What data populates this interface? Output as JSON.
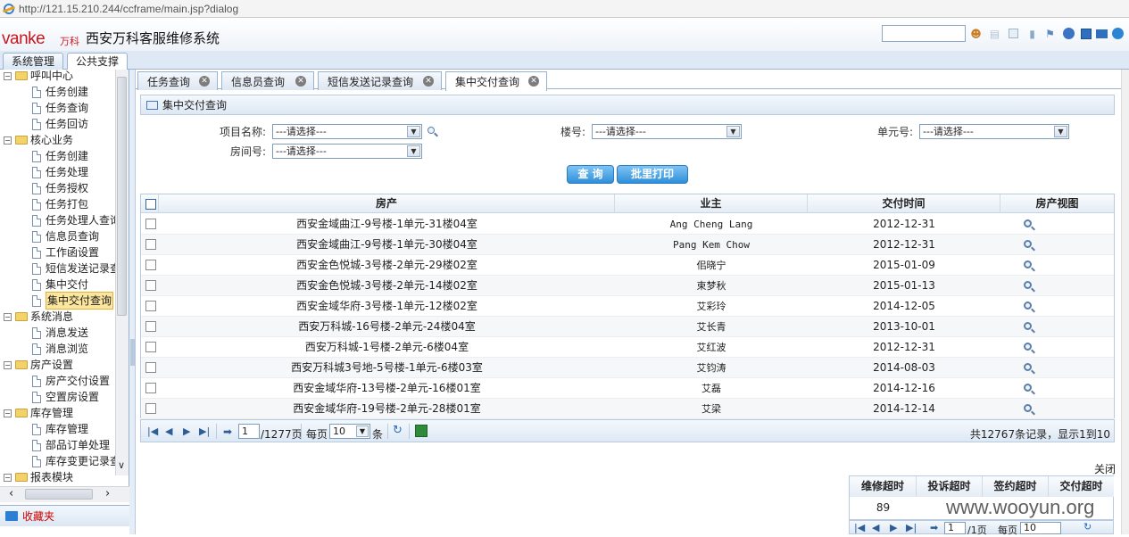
{
  "browser": {
    "url": "http://121.15.210.244/ccframe/main.jsp?dialog"
  },
  "header": {
    "logo": "vanke",
    "logo_cn": "万科",
    "title": "西安万科客服维修系统",
    "icons": [
      "users-icon",
      "document-icon",
      "close-square-icon",
      "book-icon",
      "bookmark-icon",
      "lock-icon",
      "layout-icon",
      "mail-icon",
      "help-icon"
    ]
  },
  "topnav": {
    "tabs": [
      {
        "label": "系统管理"
      },
      {
        "label": "公共支撑"
      }
    ]
  },
  "tree": {
    "nodes": [
      {
        "type": "folder",
        "label": "呼叫中心"
      },
      {
        "type": "doc",
        "label": "任务创建"
      },
      {
        "type": "doc",
        "label": "任务查询"
      },
      {
        "type": "doc",
        "label": "任务回访"
      },
      {
        "type": "folder",
        "label": "核心业务"
      },
      {
        "type": "doc",
        "label": "任务创建"
      },
      {
        "type": "doc",
        "label": "任务处理"
      },
      {
        "type": "doc",
        "label": "任务授权"
      },
      {
        "type": "doc",
        "label": "任务打包"
      },
      {
        "type": "doc",
        "label": "任务处理人查询"
      },
      {
        "type": "doc",
        "label": "信息员查询"
      },
      {
        "type": "doc",
        "label": "工作函设置"
      },
      {
        "type": "doc",
        "label": "短信发送记录查询"
      },
      {
        "type": "doc",
        "label": "集中交付"
      },
      {
        "type": "doc",
        "label": "集中交付查询",
        "selected": true
      },
      {
        "type": "folder",
        "label": "系统消息"
      },
      {
        "type": "doc",
        "label": "消息发送"
      },
      {
        "type": "doc",
        "label": "消息浏览"
      },
      {
        "type": "folder",
        "label": "房产设置"
      },
      {
        "type": "doc",
        "label": "房产交付设置"
      },
      {
        "type": "doc",
        "label": "空置房设置"
      },
      {
        "type": "folder",
        "label": "库存管理"
      },
      {
        "type": "doc",
        "label": "库存管理"
      },
      {
        "type": "doc",
        "label": "部品订单处理"
      },
      {
        "type": "doc",
        "label": "库存变更记录查询"
      },
      {
        "type": "folder",
        "label": "报表模块"
      }
    ],
    "favorites": "收藏夹"
  },
  "content_tabs": [
    {
      "label": "任务查询"
    },
    {
      "label": "信息员查询"
    },
    {
      "label": "短信发送记录查询"
    },
    {
      "label": "集中交付查询",
      "active": true
    }
  ],
  "panel": {
    "title": "集中交付查询",
    "filters": {
      "project_label": "项目名称:",
      "building_label": "楼号:",
      "unit_label": "单元号:",
      "room_label": "房间号:",
      "select_placeholder": "---请选择---"
    },
    "buttons": {
      "query": "查 询",
      "batch_print": "批里打印"
    }
  },
  "grid": {
    "columns": [
      "房产",
      "业主",
      "交付时间",
      "房产视图"
    ],
    "rows": [
      {
        "property": "西安金域曲江-9号楼-1单元-31楼04室",
        "owner": "Ang Cheng Lang",
        "date": "2012-12-31"
      },
      {
        "property": "西安金域曲江-9号楼-1单元-30楼04室",
        "owner": "Pang Kem Chow",
        "date": "2012-12-31"
      },
      {
        "property": "西安金色悦城-3号楼-2单元-29楼02室",
        "owner": "佀晓宁",
        "date": "2015-01-09"
      },
      {
        "property": "西安金色悦城-3号楼-2单元-14楼02室",
        "owner": "束梦秋",
        "date": "2015-01-13"
      },
      {
        "property": "西安金域华府-3号楼-1单元-12楼02室",
        "owner": "艾彩玲",
        "date": "2014-12-05"
      },
      {
        "property": "西安万科城-16号楼-2单元-24楼04室",
        "owner": "艾长青",
        "date": "2013-10-01"
      },
      {
        "property": "西安万科城-1号楼-2单元-6楼04室",
        "owner": "艾红波",
        "date": "2012-12-31"
      },
      {
        "property": "西安万科城3号地-5号楼-1单元-6楼03室",
        "owner": "艾钧涛",
        "date": "2014-08-03"
      },
      {
        "property": "西安金域华府-13号楼-2单元-16楼01室",
        "owner": "艾磊",
        "date": "2014-12-16"
      },
      {
        "property": "西安金域华府-19号楼-2单元-28楼01室",
        "owner": "艾梁",
        "date": "2014-12-14"
      }
    ]
  },
  "pager": {
    "page": "1",
    "total_pages": "/1277页",
    "per_page_label": "每页",
    "per_page": "10",
    "unit": "条",
    "summary": "共12767条记录，显示1到10"
  },
  "bottom": {
    "close": "关闭",
    "columns": [
      "维修超时",
      "投诉超时",
      "签约超时",
      "交付超时"
    ],
    "values": [
      "89",
      "",
      "",
      ""
    ],
    "pager_page": "1",
    "pager_total": "/1页",
    "pager_per_page_label": "每页",
    "pager_per_page": "10"
  },
  "watermark": "www.wooyun.org"
}
